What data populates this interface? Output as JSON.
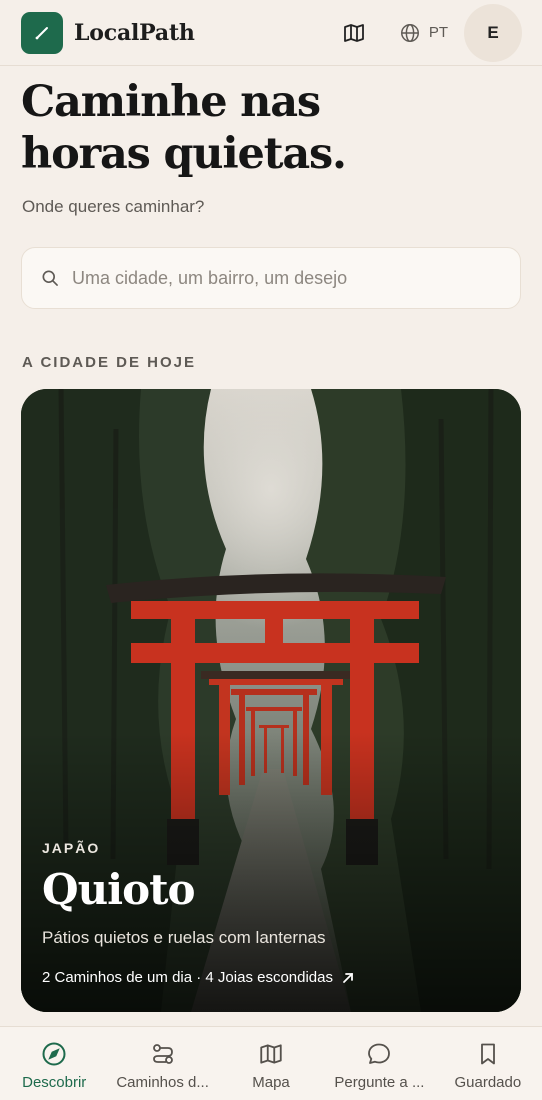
{
  "app": {
    "brand": "LocalPath",
    "language": "PT",
    "avatar_initial": "E"
  },
  "hero": {
    "title_line1": "Caminhe nas",
    "title_line2": "horas quietas.",
    "subtitle": "Onde queres caminhar?"
  },
  "search": {
    "placeholder": "Uma cidade, um bairro, um desejo",
    "value": ""
  },
  "today": {
    "section_label": "A CIDADE DE HOJE",
    "country": "JAPÃO",
    "city": "Quioto",
    "description": "Pátios quietos e ruelas com lanternas",
    "meta": "2 Caminhos de um dia · 4 Joias escondidas"
  },
  "nav": {
    "items": [
      {
        "label": "Descobrir",
        "icon": "compass-icon",
        "active": true
      },
      {
        "label": "Caminhos d...",
        "icon": "route-icon",
        "active": false
      },
      {
        "label": "Mapa",
        "icon": "map-icon",
        "active": false
      },
      {
        "label": "Pergunte a ...",
        "icon": "chat-icon",
        "active": false
      },
      {
        "label": "Guardado",
        "icon": "bookmark-icon",
        "active": false
      }
    ]
  },
  "colors": {
    "accent": "#1e6a4c",
    "background": "#f5efe9",
    "torii": "#c8321f"
  }
}
